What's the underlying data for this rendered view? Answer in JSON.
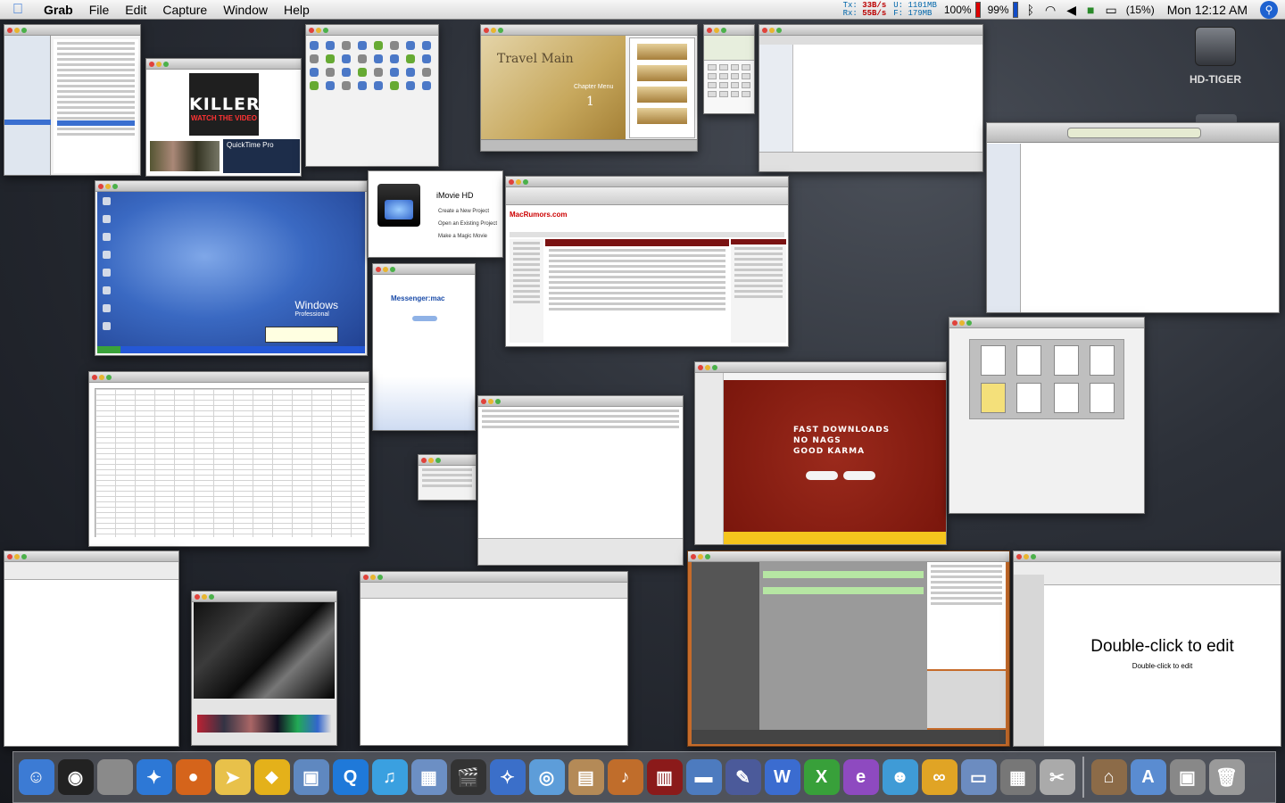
{
  "menubar": {
    "apple": "",
    "app_name": "Grab",
    "menus": [
      "File",
      "Edit",
      "Capture",
      "Window",
      "Help"
    ],
    "net_tx_label": "Tx:",
    "net_tx": "33B/s",
    "net_rx_label": "Rx:",
    "net_rx": "55B/s",
    "mem_u": "U: 1101MB",
    "mem_f": "F:  179MB",
    "cpu1": "100%",
    "cpu2": "99%",
    "battery": "(15%)",
    "clock": "Mon 12:12 AM"
  },
  "desktop": {
    "drive_label": "HD-TIGER"
  },
  "windows": {
    "music": {
      "album": "KILLERS",
      "video": "WATCH THE VIDEO",
      "qt": "QuickTime Pro"
    },
    "idvd": {
      "title": "Travel Main",
      "sub": "Chapter Menu",
      "num": "1"
    },
    "imovie": {
      "title": "iMovie HD",
      "opt1": "Create a New Project",
      "opt2": "Open an Existing Project",
      "opt3": "Make a Magic Movie"
    },
    "browser": {
      "site": "MacRumors.com"
    },
    "msn": {
      "logo": "Messenger:mac"
    },
    "limewire": {
      "line1": "FAST DOWNLOADS",
      "line2": "NO NAGS",
      "line3": "GOOD KARMA"
    },
    "vpc": {
      "logo": "Windows",
      "edition": "Professional"
    },
    "keynote": {
      "title": "Double-click to edit",
      "subtitle": "Double-click to edit"
    }
  },
  "dock": {
    "apps": [
      {
        "name": "Finder",
        "color": "#3c7bd4",
        "glyph": "☺"
      },
      {
        "name": "Dashboard",
        "color": "#222222",
        "glyph": "◉"
      },
      {
        "name": "Mac",
        "color": "#8a8a8a",
        "glyph": ""
      },
      {
        "name": "Safari",
        "color": "#2d78d6",
        "glyph": "✦"
      },
      {
        "name": "Firefox",
        "color": "#d5641b",
        "glyph": "●"
      },
      {
        "name": "Mail",
        "color": "#e8c14a",
        "glyph": "➤"
      },
      {
        "name": "Transmit",
        "color": "#e4b11a",
        "glyph": "⬥"
      },
      {
        "name": "Xcode",
        "color": "#5f88c0",
        "glyph": "▣"
      },
      {
        "name": "QuickTime",
        "color": "#1f79d9",
        "glyph": "Q"
      },
      {
        "name": "iTunes",
        "color": "#3aa0e0",
        "glyph": "♫"
      },
      {
        "name": "iPhoto",
        "color": "#6c8fc4",
        "glyph": "▦"
      },
      {
        "name": "iMovie",
        "color": "#333333",
        "glyph": "🎬"
      },
      {
        "name": "iDVD",
        "color": "#3b6fc9",
        "glyph": "✧"
      },
      {
        "name": "DVD",
        "color": "#5d9dd9",
        "glyph": "◎"
      },
      {
        "name": "iWeb",
        "color": "#b48a57",
        "glyph": "▤"
      },
      {
        "name": "GarageBand",
        "color": "#c06d2b",
        "glyph": "♪"
      },
      {
        "name": "Keynote",
        "color": "#8b1a1a",
        "glyph": "▥"
      },
      {
        "name": "Presentation",
        "color": "#4d7bbf",
        "glyph": "▬"
      },
      {
        "name": "Pen",
        "color": "#4b5a9a",
        "glyph": "✎"
      },
      {
        "name": "Word",
        "color": "#3b6cd0",
        "glyph": "W"
      },
      {
        "name": "Excel",
        "color": "#38a03a",
        "glyph": "X"
      },
      {
        "name": "Entourage",
        "color": "#8e4ac0",
        "glyph": "e"
      },
      {
        "name": "Messenger",
        "color": "#3f9bd6",
        "glyph": "☻"
      },
      {
        "name": "Office",
        "color": "#e0a425",
        "glyph": "∞"
      },
      {
        "name": "Classic",
        "color": "#6c8cc0",
        "glyph": "▭"
      },
      {
        "name": "Calculator",
        "color": "#777777",
        "glyph": "▦"
      },
      {
        "name": "Grab",
        "color": "#aaaaaa",
        "glyph": "✂"
      }
    ],
    "right": [
      {
        "name": "Home",
        "color": "#8c6b48",
        "glyph": "⌂"
      },
      {
        "name": "Applications",
        "color": "#5a8cd1",
        "glyph": "A"
      },
      {
        "name": "Drive",
        "color": "#888888",
        "glyph": "▣"
      },
      {
        "name": "Trash",
        "color": "#9a9a9a",
        "glyph": "🗑"
      }
    ]
  }
}
